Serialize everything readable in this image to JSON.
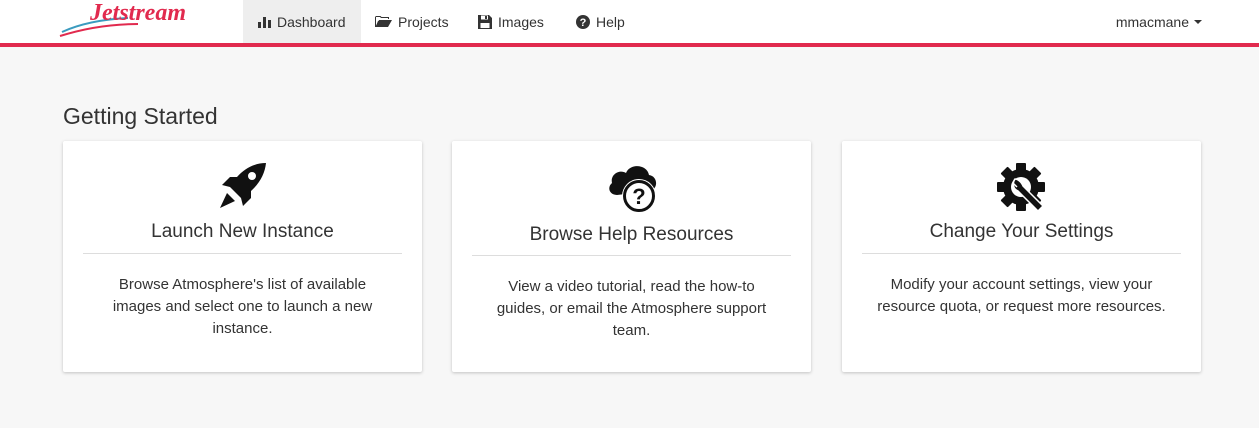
{
  "brand": {
    "name": "Jetstream",
    "color": "#e12a4e"
  },
  "nav": {
    "items": [
      {
        "label": "Dashboard",
        "icon": "bar-chart-icon",
        "active": true
      },
      {
        "label": "Projects",
        "icon": "folder-open-icon",
        "active": false
      },
      {
        "label": "Images",
        "icon": "floppy-disk-icon",
        "active": false
      },
      {
        "label": "Help",
        "icon": "question-circle-icon",
        "active": false
      }
    ],
    "user": {
      "name": "mmacmane",
      "icon": "caret-down-icon"
    }
  },
  "main": {
    "title": "Getting Started",
    "cards": [
      {
        "icon": "rocket-icon",
        "title": "Launch New Instance",
        "description": "Browse Atmosphere's list of available images and select one to launch a new instance."
      },
      {
        "icon": "cloud-help-icon",
        "title": "Browse Help Resources",
        "description": "View a video tutorial, read the how-to guides, or email the Atmosphere support team."
      },
      {
        "icon": "settings-wrench-icon",
        "title": "Change Your Settings",
        "description": "Modify your account settings, view your resource quota, or request more resources."
      }
    ]
  }
}
